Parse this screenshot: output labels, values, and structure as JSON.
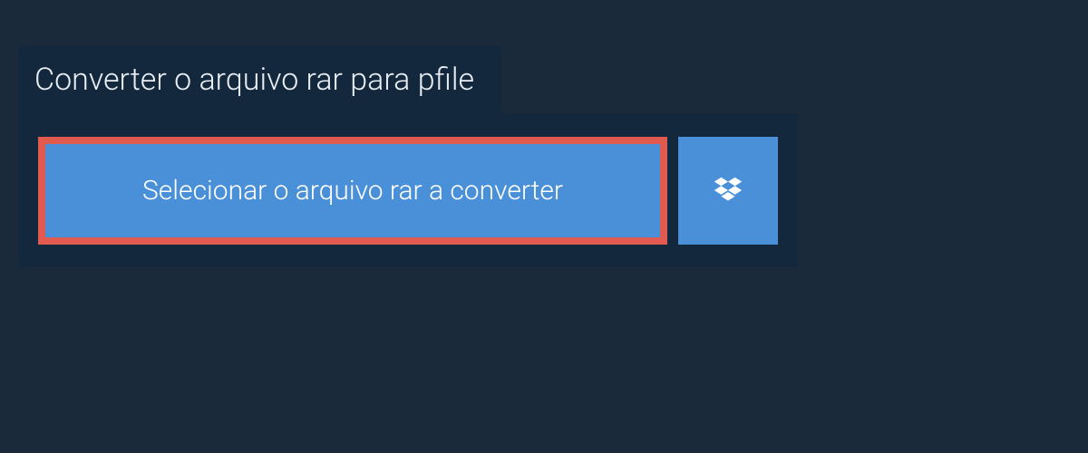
{
  "header": {
    "title": "Converter o arquivo rar para pfile"
  },
  "upload": {
    "select_button_label": "Selecionar o arquivo rar a converter",
    "dropbox_icon_name": "dropbox"
  },
  "colors": {
    "background": "#1a2a3a",
    "panel": "#13283d",
    "button": "#4a90d9",
    "highlight_border": "#e05a4f",
    "text_light": "#e8eef4",
    "text_white": "#ffffff"
  }
}
